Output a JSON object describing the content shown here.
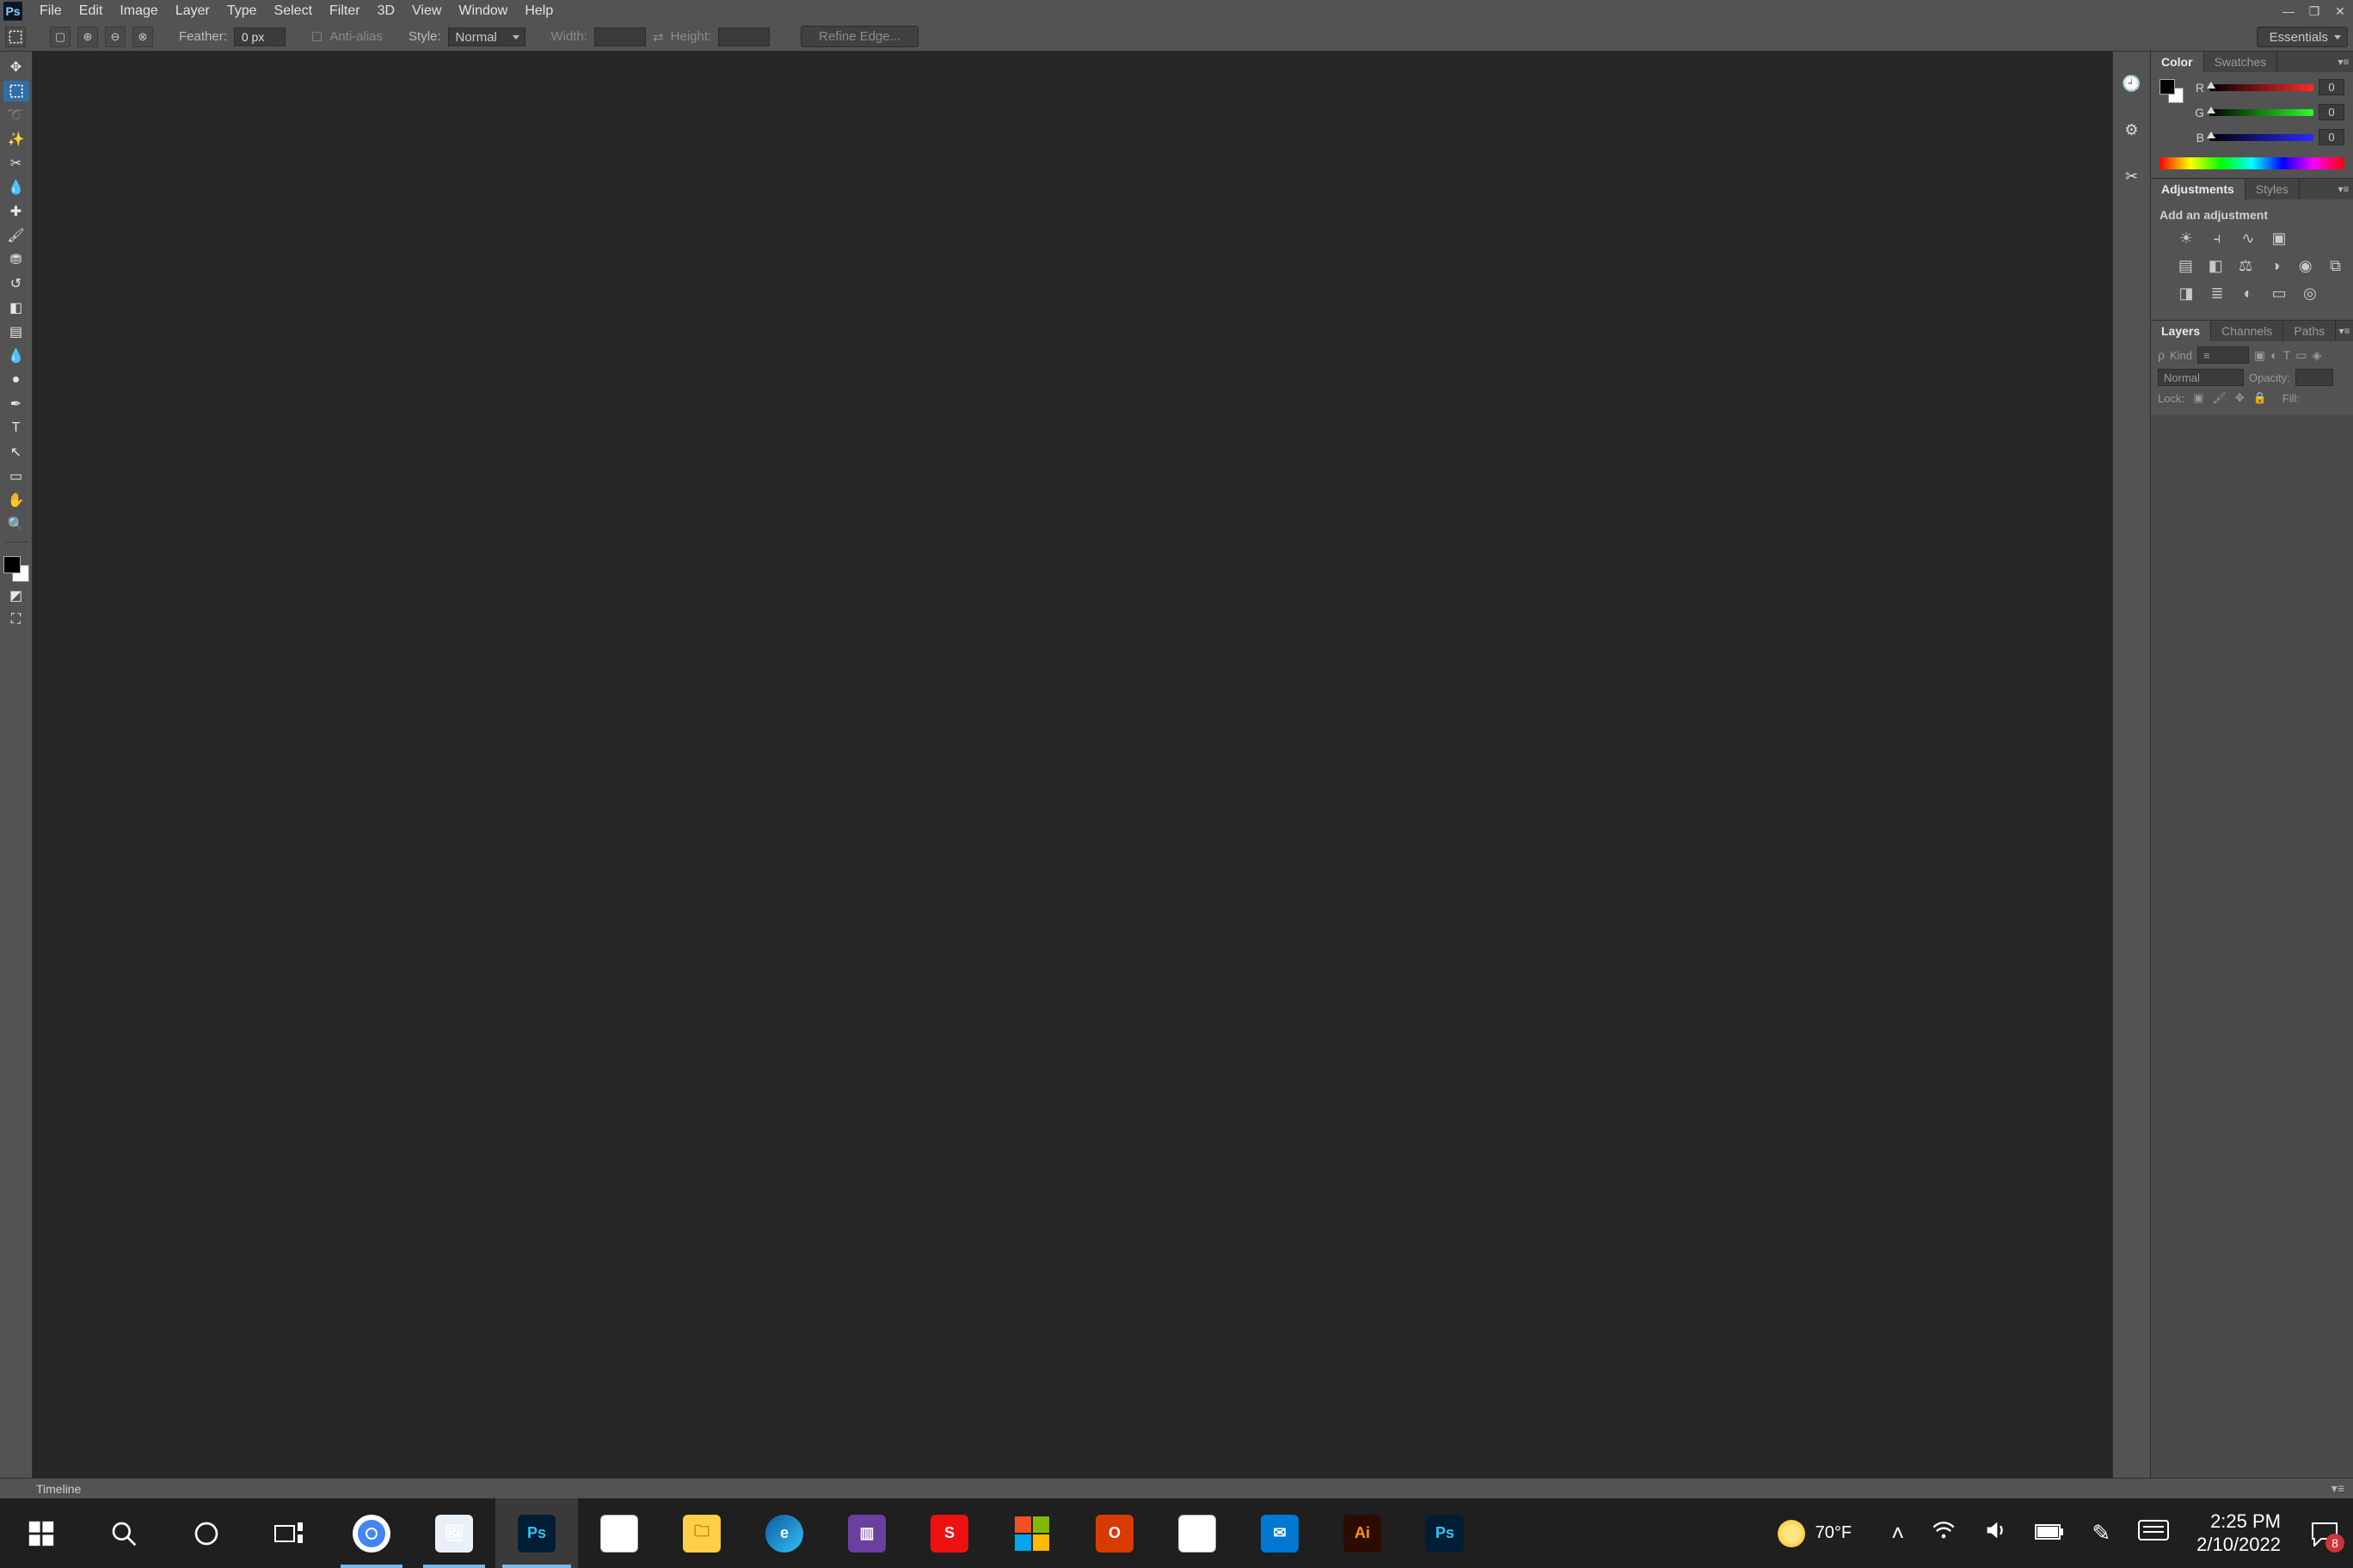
{
  "menu": {
    "items": [
      "File",
      "Edit",
      "Image",
      "Layer",
      "Type",
      "Select",
      "Filter",
      "3D",
      "View",
      "Window",
      "Help"
    ]
  },
  "options": {
    "feather_label": "Feather:",
    "feather_value": "0 px",
    "antialias_label": "Anti-alias",
    "style_label": "Style:",
    "style_value": "Normal",
    "width_label": "Width:",
    "height_label": "Height:",
    "refine_label": "Refine Edge...",
    "workspace": "Essentials"
  },
  "panels": {
    "color": {
      "tab_color": "Color",
      "tab_swatches": "Swatches",
      "r_value": "0",
      "g_value": "0",
      "b_value": "0",
      "r_label": "R",
      "g_label": "G",
      "b_label": "B"
    },
    "adjustments": {
      "tab_adjustments": "Adjustments",
      "tab_styles": "Styles",
      "title": "Add an adjustment"
    },
    "layers": {
      "tab_layers": "Layers",
      "tab_channels": "Channels",
      "tab_paths": "Paths",
      "kind_label": "Kind",
      "blend_value": "Normal",
      "opacity_label": "Opacity:",
      "lock_label": "Lock:",
      "fill_label": "Fill:"
    }
  },
  "timeline": {
    "label": "Timeline"
  },
  "taskbar": {
    "weather_temp": "70°F",
    "time": "2:25 PM",
    "date": "2/10/2022",
    "action_center_count": "8"
  }
}
